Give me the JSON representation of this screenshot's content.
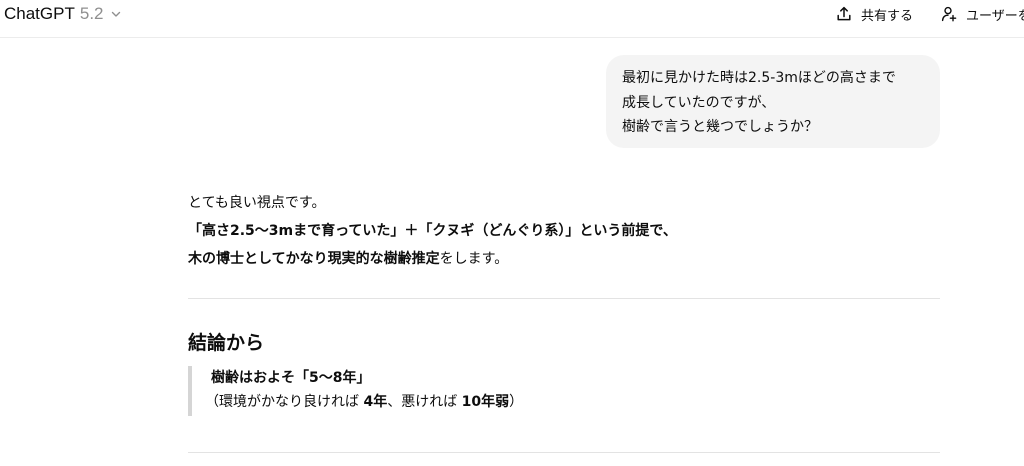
{
  "header": {
    "model_name": "ChatGPT",
    "model_version": "5.2",
    "share_label": "共有する",
    "add_user_label": "ユーザーを"
  },
  "user_message": {
    "lines": [
      "最初に見かけた時は2.5-3mほどの高さまで",
      "成長していたのですが、",
      "樹齢で言うと幾つでしょうか？"
    ]
  },
  "assistant_message": {
    "intro": "とても良い視点です。",
    "premise": "「高さ2.5〜3mまで育っていた」＋「クヌギ（どんぐり系）」という前提で、",
    "estimate_bold": "木の博士としてかなり現実的な樹齢推定",
    "estimate_rest": "をします。",
    "section_heading": "結論から",
    "quote": {
      "main": "樹齢はおよそ「5〜8年」",
      "detail_prefix": "（環境がかなり良ければ ",
      "detail_good": "4年",
      "detail_mid": "、悪ければ ",
      "detail_bad": "10年弱",
      "detail_suffix": "）"
    }
  },
  "icons": {
    "model_dropdown": "chevron-down-icon",
    "share": "share-upload-icon",
    "add_user": "person-plus-icon"
  }
}
